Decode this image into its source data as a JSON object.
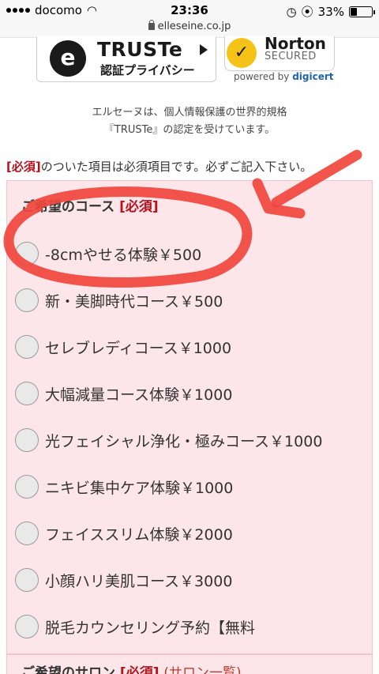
{
  "status_bar": {
    "carrier": "docomo",
    "time": "23:36",
    "battery": "33%",
    "battery_level": 0.33
  },
  "url_bar": {
    "domain": "elleseine.co.jp"
  },
  "badges": {
    "truste_logo_letter": "e",
    "truste_name": "TRUSTe",
    "truste_sub": "認証プライバシー",
    "norton_name": "Norton",
    "norton_sub": "SECURED",
    "powered_by": "powered by",
    "digicert": "digicert"
  },
  "intro": {
    "line1": "エルセーヌは、個人情報保護の世界的規格",
    "line2": "『TRUSTe』の認定を受けています。"
  },
  "notice": {
    "required_tag": "[必須]",
    "text": "のついた項目は必須項目です。必ずご記入下さい。"
  },
  "course_section": {
    "title": "ご希望のコース",
    "required_tag": "[必須]",
    "options": [
      {
        "label": "-8cmやせる体験￥500"
      },
      {
        "label": "新・美脚時代コース￥500"
      },
      {
        "label": "セレブレディコース￥1000"
      },
      {
        "label": "大幅減量コース体験￥1000"
      },
      {
        "label": "光フェイシャル浄化・極みコース￥1000"
      },
      {
        "label": "ニキビ集中ケア体験￥1000"
      },
      {
        "label": "フェイススリム体験￥2000"
      },
      {
        "label": "小顔ハリ美肌コース￥3000"
      },
      {
        "label": "脱毛カウンセリング予約【無料"
      }
    ]
  },
  "salon_section": {
    "title": "ご希望のサロン",
    "required_tag": "[必須]",
    "link": "(サロン一覧)"
  },
  "colors": {
    "section_bg": "#fde6ea",
    "required": "#b5121b",
    "annotation": "#f0463c"
  }
}
